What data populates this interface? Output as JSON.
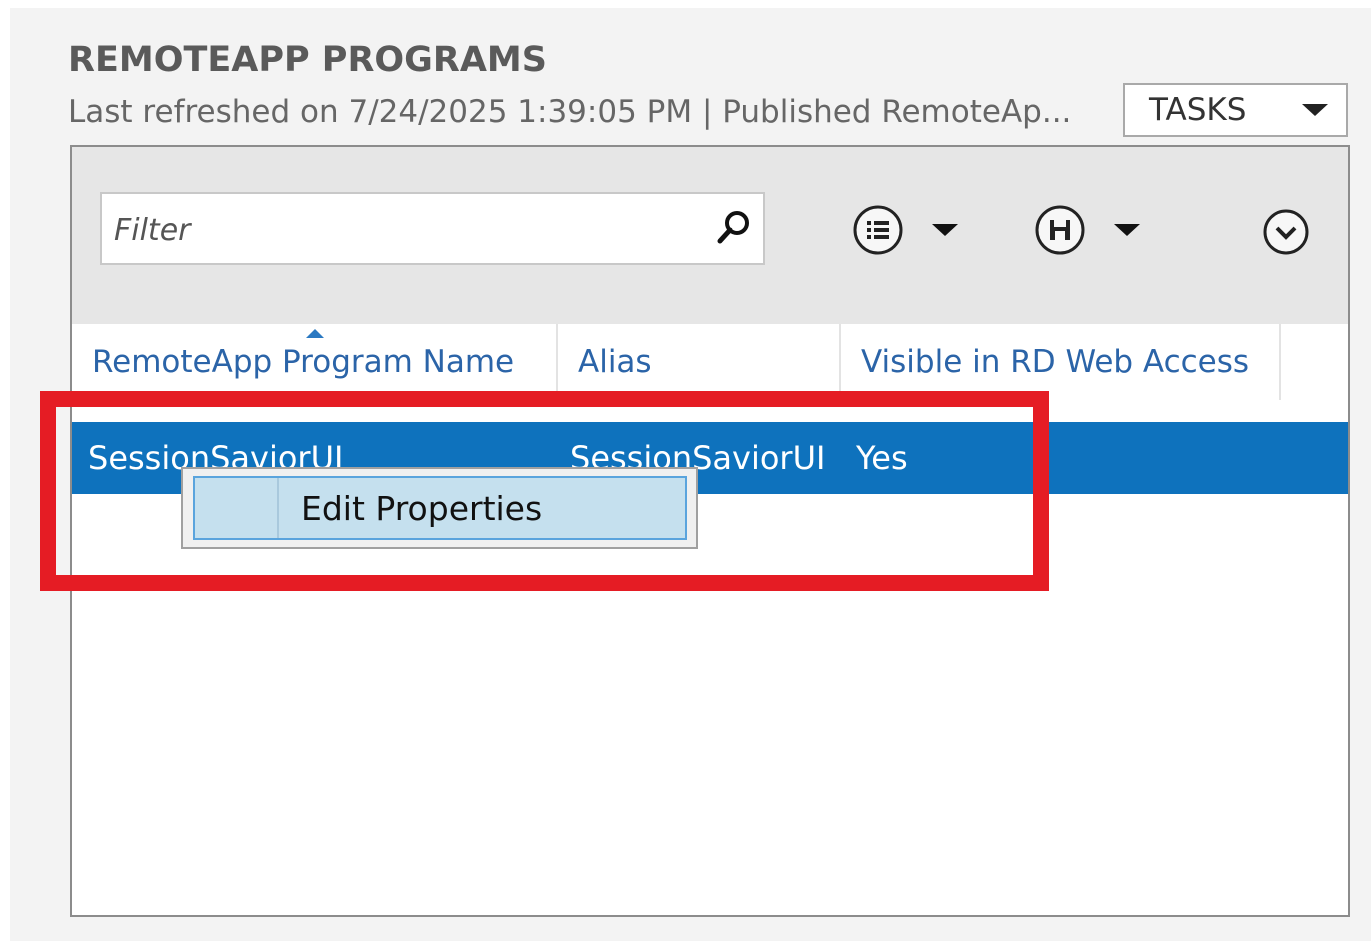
{
  "section": {
    "title": "REMOTEAPP PROGRAMS",
    "subtitle": "Last refreshed on 7/24/2025 1:39:05 PM | Published RemoteAp..."
  },
  "tasks": {
    "label": "TASKS"
  },
  "filter": {
    "placeholder": "Filter"
  },
  "table": {
    "columns": [
      "RemoteApp Program Name",
      "Alias",
      "Visible in RD Web Access"
    ],
    "sort_column": "RemoteApp Program Name",
    "sort_direction": "ascending",
    "rows": [
      {
        "name": "SessionSaviorUI",
        "alias": "SessionSaviorUI",
        "visible": "Yes",
        "selected": true
      }
    ]
  },
  "context_menu": {
    "items": [
      "Edit Properties"
    ]
  },
  "icons": {
    "search": "search-icon",
    "view_options": "list-view-icon",
    "save_query": "save-icon",
    "expand": "chevron-down-circle-icon"
  },
  "colors": {
    "selection": "#0e72bd",
    "header_text": "#2b64a8",
    "menu_highlight": "#c5e0ee",
    "annotation": "#e51c24"
  }
}
